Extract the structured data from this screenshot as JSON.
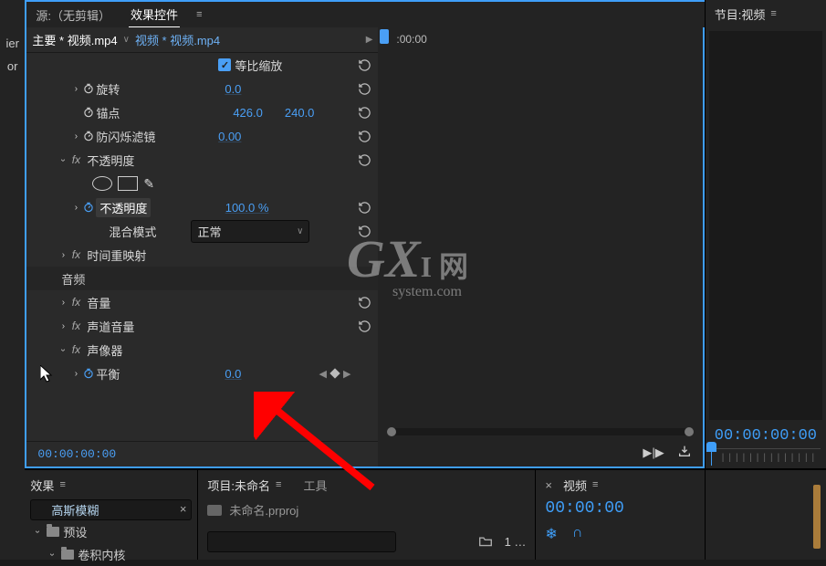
{
  "tabs": {
    "source": "源:（无剪辑）",
    "effect_controls": "效果控件"
  },
  "clip_header": {
    "master": "主要 * 视频.mp4",
    "instance": "视频 * 视频.mp4"
  },
  "properties": {
    "uniform_scale": "等比缩放",
    "rotation": {
      "label": "旋转",
      "value": "0.0"
    },
    "anchor": {
      "label": "锚点",
      "x": "426.0",
      "y": "240.0"
    },
    "anti_flicker": {
      "label": "防闪烁滤镜",
      "value": "0.00"
    },
    "opacity_group": "不透明度",
    "opacity": {
      "label": "不透明度",
      "value": "100.0 %"
    },
    "blend_mode": {
      "label": "混合模式",
      "value": "正常"
    },
    "time_remap": "时间重映射",
    "audio_header": "音频",
    "volume": "音量",
    "channel_volume": "声道音量",
    "panner": "声像器",
    "balance": {
      "label": "平衡",
      "value": "0.0"
    }
  },
  "timeline": {
    "timecode": "00:00:00:00",
    "ruler_start": ":00:00"
  },
  "program_panel": {
    "title": "节目:视频",
    "timecode": "00:00:00:00"
  },
  "effects_panel": {
    "title": "效果",
    "search_value": "高斯模糊",
    "presets": "预设",
    "convolution": "卷积内核"
  },
  "project_panel": {
    "title": "项目:未命名",
    "tools": "工具",
    "filename": "未命名.prproj",
    "item_count": "1 …"
  },
  "sequence_panel": {
    "title": "视频",
    "timecode": "00:00:00"
  },
  "left_edge": {
    "ier": "ier",
    "or": "or"
  },
  "watermark": {
    "big": "GX",
    "mid": "I 网",
    "sm": "system.com"
  }
}
